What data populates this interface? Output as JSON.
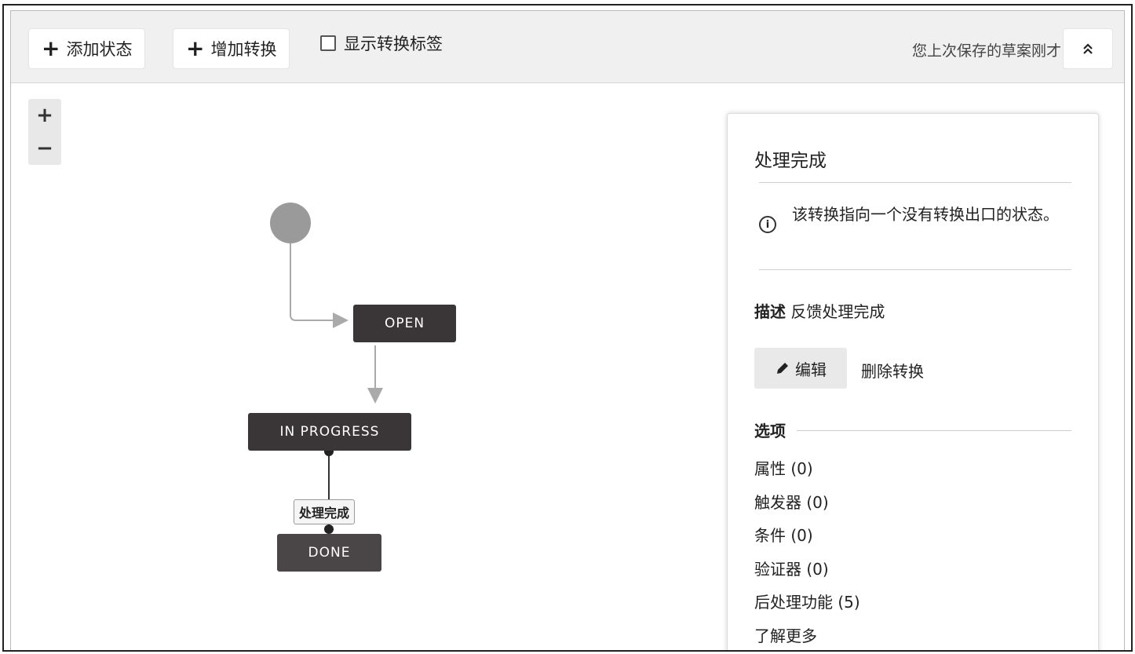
{
  "toolbar": {
    "add_state_label": "添加状态",
    "add_transition_label": "增加转换",
    "show_labels_text": "显示转换标签",
    "saved_status": "您上次保存的草案刚才"
  },
  "zoom": {
    "in": "+",
    "out": "−"
  },
  "workflow": {
    "nodes": {
      "open": "OPEN",
      "in_progress": "IN PROGRESS",
      "done": "DONE"
    },
    "transition_label": "处理完成"
  },
  "panel": {
    "title": "处理完成",
    "info": "该转换指向一个没有转换出口的状态。",
    "description_label": "描述",
    "description_value": "反馈处理完成",
    "edit_label": "编辑",
    "delete_label": "删除转换",
    "options_heading": "选项",
    "options": [
      "属性 (0)",
      "触发器 (0)",
      "条件 (0)",
      "验证器 (0)",
      "后处理功能 (5)",
      "了解更多"
    ]
  }
}
